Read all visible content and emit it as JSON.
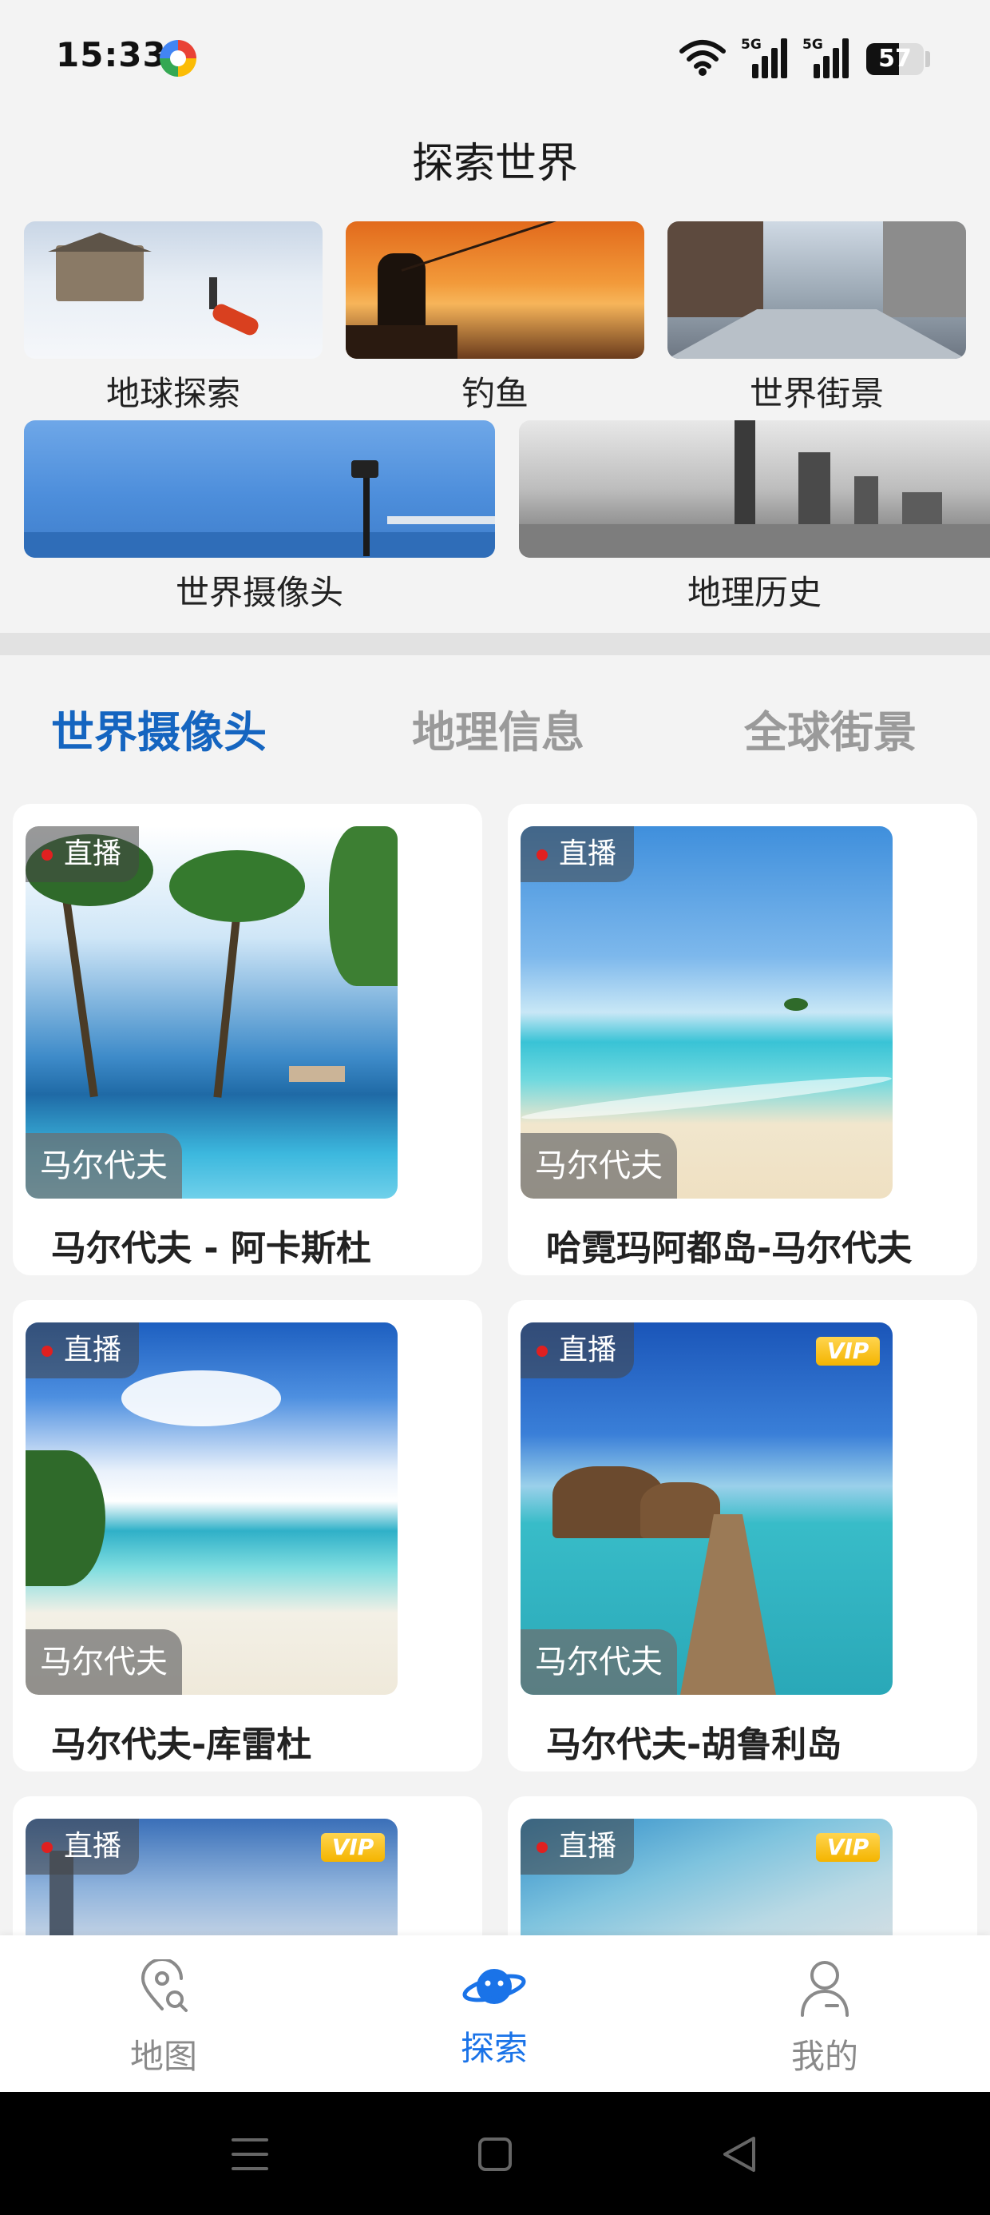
{
  "status_bar": {
    "time": "15:33",
    "battery": "57",
    "battery_level": 0.57,
    "sim1_label": "5G",
    "sim2_label": "5G"
  },
  "header": {
    "title": "探索世界"
  },
  "categories": [
    {
      "label": "地球探索"
    },
    {
      "label": "钓鱼"
    },
    {
      "label": "世界街景"
    },
    {
      "label": "世界摄像头"
    },
    {
      "label": "地理历史"
    }
  ],
  "tabs": [
    {
      "label": "世界摄像头",
      "active": true
    },
    {
      "label": "地理信息",
      "active": false
    },
    {
      "label": "全球街景",
      "active": false
    }
  ],
  "cameras": [
    {
      "badge": "直播",
      "location": "马尔代夫",
      "title": "马尔代夫 - 阿卡斯杜",
      "vip": false
    },
    {
      "badge": "直播",
      "location": "马尔代夫",
      "title": "哈霓玛阿都岛-马尔代夫",
      "vip": false
    },
    {
      "badge": "直播",
      "location": "马尔代夫",
      "title": "马尔代夫-库雷杜",
      "vip": false
    },
    {
      "badge": "直播",
      "location": "马尔代夫",
      "title": "马尔代夫-胡鲁利岛",
      "vip": true,
      "vip_label": "VIP"
    },
    {
      "badge": "直播",
      "vip": true,
      "vip_label": "VIP"
    },
    {
      "badge": "直播",
      "vip": true,
      "vip_label": "VIP"
    }
  ],
  "bottom_nav": [
    {
      "label": "地图",
      "icon": "map-pin-icon",
      "active": false
    },
    {
      "label": "探索",
      "icon": "planet-icon",
      "active": true
    },
    {
      "label": "我的",
      "icon": "user-icon",
      "active": false
    }
  ],
  "colors": {
    "accent": "#1565c0",
    "nav_active": "#1a73e8",
    "live_dot": "#e02020",
    "vip": "#f4b400"
  }
}
